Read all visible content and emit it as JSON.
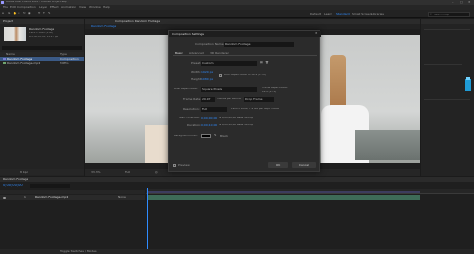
{
  "window": {
    "title": "Adobe After Effects 2020 - Untitled Project.aep *"
  },
  "menu": [
    "File",
    "Edit",
    "Composition",
    "Layer",
    "Effect",
    "Animation",
    "View",
    "Window",
    "Help"
  ],
  "workspaces": [
    "Default",
    "Learn",
    "Standard",
    "Small Screen",
    "Libraries"
  ],
  "search_placeholder": "Search Help",
  "project": {
    "tab": "Project",
    "comp_name": "Random Footage",
    "comp_meta": "1920 x 1080 (1.00)",
    "comp_meta2": "Δ 0;00;10;00, 29.97 fps",
    "columns": [
      "Name",
      "Type"
    ],
    "items": [
      {
        "name": "Random Footage",
        "type": "Composition",
        "selected": true
      },
      {
        "name": "Random Footage.mp4",
        "type": "MPEG",
        "selected": false
      }
    ],
    "bpc": "8 bpc"
  },
  "viewer": {
    "tab": "Composition Random Footage",
    "subtab": "Random Footage",
    "zoom": "33.3%",
    "quality": "Full"
  },
  "dialog": {
    "title": "Composition Settings",
    "name_label": "Composition Name:",
    "name_value": "Random Footage",
    "tabs": [
      "Basic",
      "Advanced",
      "3D Renderer"
    ],
    "preset_label": "Preset:",
    "preset_value": "Custom",
    "width_label": "Width:",
    "width_value": "1920 px",
    "lock_label": "Lock Aspect Ratio to 16:9 (1.78)",
    "height_label": "Height:",
    "height_value": "1080 px",
    "par_label": "Pixel Aspect Ratio:",
    "par_value": "Square Pixels",
    "far_label": "Frame Aspect Ratio:",
    "far_value": "16:9 (1.78)",
    "fps_label": "Frame Rate:",
    "fps_value": "29.97",
    "fps_unit": "frames per second",
    "drop_value": "Drop Frame",
    "res_label": "Resolution:",
    "res_value": "Full",
    "res_info": "1920 x 1080, 7.9 MB per 8bpc frame",
    "start_label": "Start Timecode:",
    "start_value": "0;00;00;00",
    "start_info": "is 0;00;00;00 Base 30drop",
    "dur_label": "Duration:",
    "dur_value": "0;00;10;00",
    "dur_info": "is 0;00;10;00 Base 30drop",
    "bg_label": "Background Color:",
    "bg_name": "Black",
    "preview_label": "Preview",
    "ok": "OK",
    "cancel": "Cancel"
  },
  "timeline": {
    "tab": "Random Footage",
    "timecode": "0;00;00;00",
    "layer_name": "Random Footage.mp4",
    "layer_mode": "None",
    "footer": "Toggle Switches / Modes"
  },
  "colors": {
    "accent": "#2f8cff",
    "bg": "#1b1b1b",
    "panel": "#232323",
    "dialog": "#2b2b2b",
    "teal": "#1f9bd6"
  }
}
